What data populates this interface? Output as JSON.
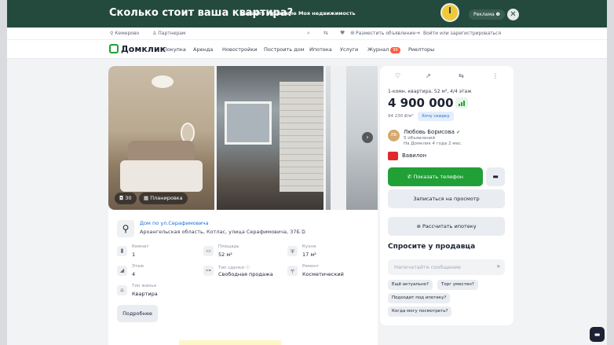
{
  "banner": {
    "title": "Сколько стоит ваша квартира?",
    "subtitle": "Узнайте в разделе Моя недвижимость",
    "ad_label": "Реклама ❶",
    "close_icon": "close-icon"
  },
  "topbar": {
    "city": "⚲ Кемерово",
    "partners": "♙ Партнерам",
    "place_ad": "Разместить объявление",
    "login": "Войти или зарегистрироваться"
  },
  "nav": {
    "logo": "Домклик",
    "items": [
      "Покупка",
      "Аренда",
      "Новостройки",
      "Построить дом",
      "Ипотека",
      "Услуги",
      "Журнал",
      "Риелторы"
    ],
    "journal_badge": "99"
  },
  "gallery": {
    "photo_count": "30",
    "plan_label": "Планировка",
    "next_icon": "chevron-right-icon"
  },
  "listing": {
    "building": "Дом по ул.Серафимовича",
    "address": "Архангельская область, Котлас, улица Серафимовича, 37Б",
    "specs": [
      {
        "label": "Комнат",
        "value": "1",
        "icon": "door-icon"
      },
      {
        "label": "Площадь",
        "value": "52 м²",
        "icon": "area-icon"
      },
      {
        "label": "Кухня",
        "value": "17 м²",
        "icon": "kitchen-icon"
      },
      {
        "label": "Этаж",
        "value": "4",
        "icon": "stairs-icon"
      },
      {
        "label": "Тип сделки",
        "value": "Свободная продажа",
        "icon": "key-icon"
      },
      {
        "label": "Ремонт",
        "value": "Косметический",
        "icon": "paint-roller-icon"
      },
      {
        "label": "Тип жилья",
        "value": "Квартира",
        "icon": "home-icon"
      }
    ],
    "deal_info_icon": "info-icon",
    "more_button": "Подробнее"
  },
  "card": {
    "rooms_line": "1-комн. квартира, 52 м², 4/4 этаж",
    "price": "4 900 000 ₽",
    "price_per_m": "94 230 ₽/м²",
    "discount_button": "Хочу скидку",
    "agent": {
      "initials": "ЛБ",
      "name": "Любовь Борисова",
      "listings": "5 объявлений",
      "since": "На Домклик 4 года 2 мес."
    },
    "agency": "Вавилон",
    "phone_button": "Показать телефон",
    "schedule_button": "Записаться на просмотр",
    "mortgage_button": "Рассчитать ипотеку",
    "ask_title": "Спросите у продавца",
    "message_placeholder": "Напечатайте сообщение",
    "chips": [
      "Ещё актуально?",
      "Торг уместен?",
      "Подходит под ипотеку?",
      "Когда могу посмотреть?"
    ]
  },
  "colors": {
    "banner_bg": "#234a3d",
    "accent_green": "#21a038",
    "link_blue": "#1b6ed8",
    "badge_red": "#ff5a3d"
  }
}
